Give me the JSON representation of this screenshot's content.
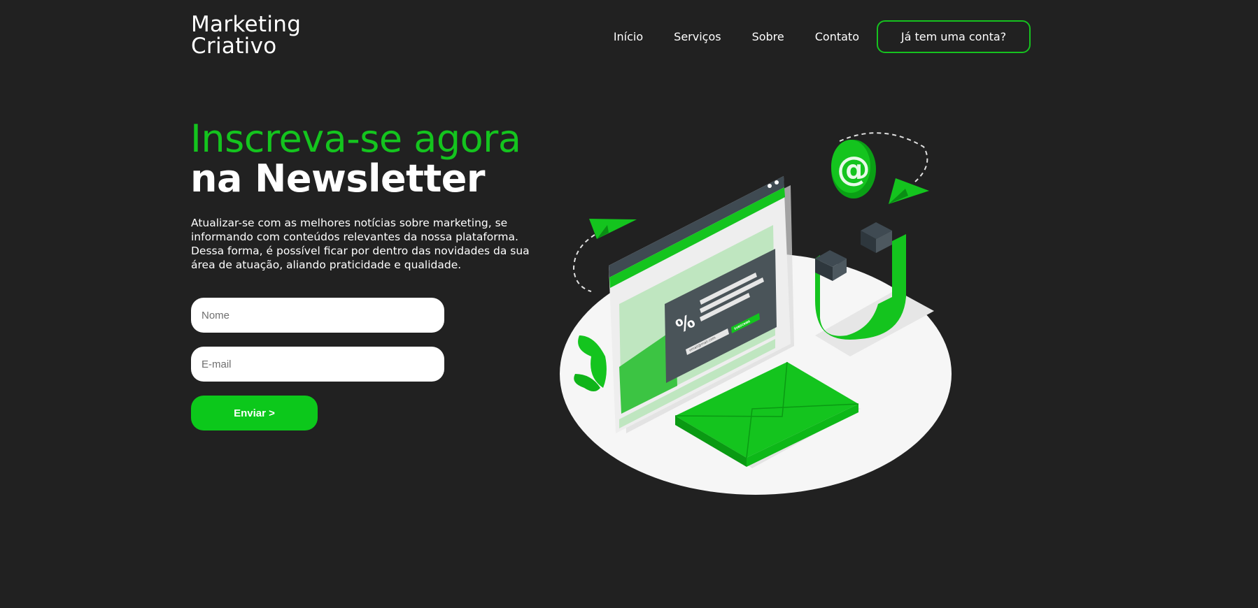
{
  "header": {
    "logo_line1": "Marketing",
    "logo_line2": "Criativo",
    "nav": [
      {
        "label": "Início"
      },
      {
        "label": "Serviços"
      },
      {
        "label": "Sobre"
      },
      {
        "label": "Contato"
      }
    ],
    "login_label": "Já tem uma conta?"
  },
  "hero": {
    "title_line1": "Inscreva-se agora",
    "title_line2": "na Newsletter",
    "description": "Atualizar-se com as melhores notícias sobre marketing, se informando com conteúdos relevantes da nossa plataforma. Dessa forma, é possível ficar por dentro das novidades da sua área de atuação, aliando praticidade e qualidade."
  },
  "form": {
    "name_placeholder": "Nome",
    "email_placeholder": "E-mail",
    "submit_label": "Enviar >"
  },
  "illustration": {
    "percent_symbol": "%",
    "at_symbol": "@",
    "subscribe_label": "SUBSCRIBE",
    "email_label": "email@mail.com"
  },
  "colors": {
    "background": "#212121",
    "accent_green": "#14c41e",
    "button_green": "#0cc81b",
    "text": "#ffffff"
  }
}
